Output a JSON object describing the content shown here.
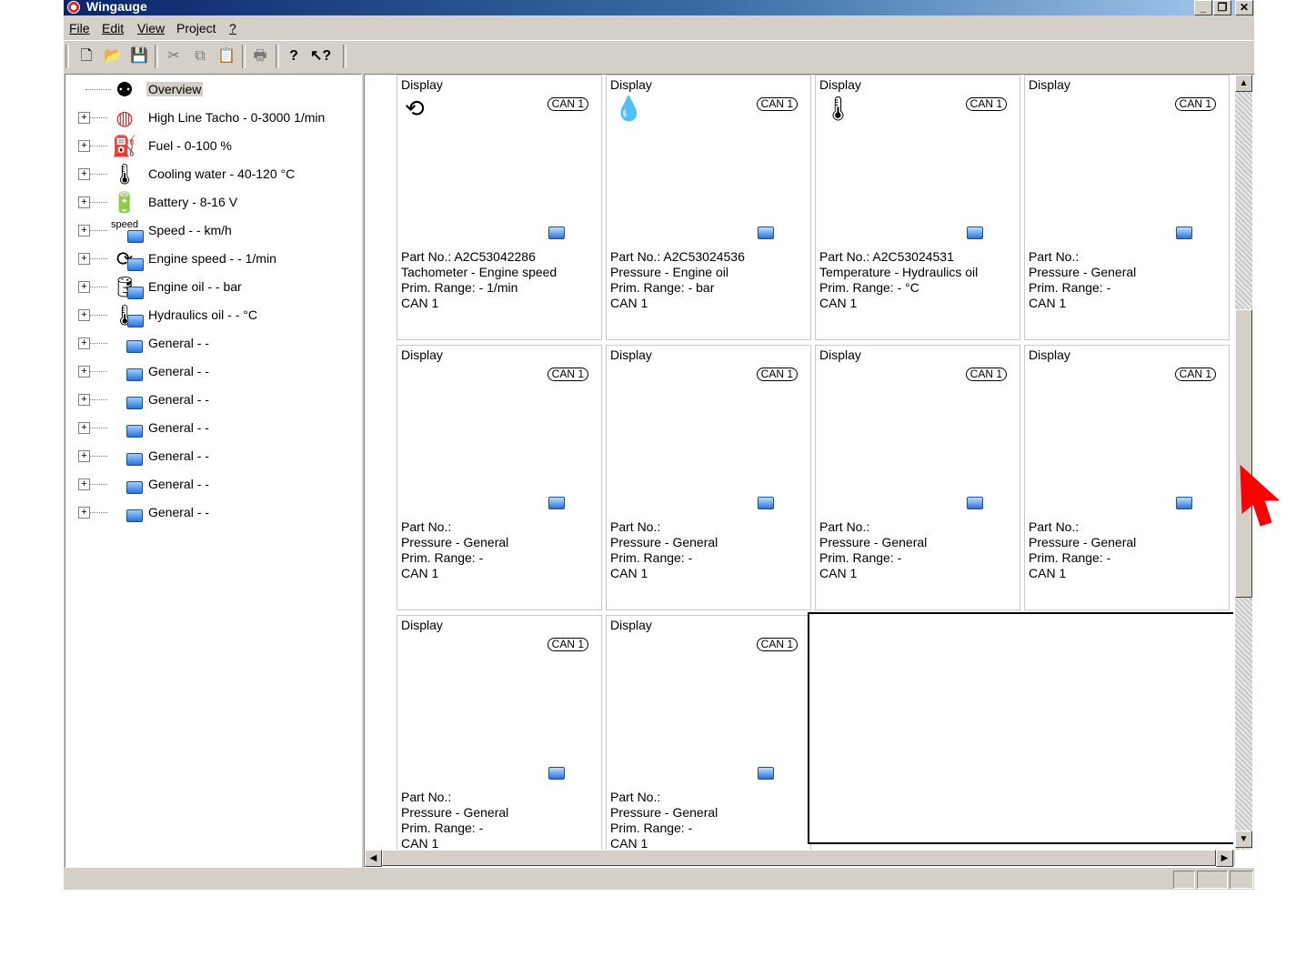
{
  "window": {
    "title": "Wingauge"
  },
  "menu": [
    {
      "label": "File"
    },
    {
      "label": "Edit"
    },
    {
      "label": "View"
    },
    {
      "label": "Project"
    },
    {
      "label": "?"
    }
  ],
  "toolbar": {
    "icons": [
      "new-document-icon",
      "open-folder-icon",
      "save-icon",
      "cut-icon",
      "copy-icon",
      "paste-icon",
      "print-icon",
      "help-icon",
      "context-help-icon"
    ]
  },
  "tree": {
    "items": [
      {
        "label": "Overview",
        "icon": "overview-icon"
      },
      {
        "label": "High Line Tacho - 0-3000 1/min",
        "icon": "tacho-icon"
      },
      {
        "label": "Fuel - 0-100 %",
        "icon": "fuel-icon"
      },
      {
        "label": "Cooling water - 40-120 °C",
        "icon": "cooling-water-icon"
      },
      {
        "label": "Battery - 8-16 V",
        "icon": "battery-icon"
      },
      {
        "label": "Speed - - km/h",
        "icon": "speed-icon"
      },
      {
        "label": "Engine speed - - 1/min",
        "icon": "engine-speed-icon"
      },
      {
        "label": "Engine oil - - bar",
        "icon": "engine-oil-icon"
      },
      {
        "label": "Hydraulics oil - - °C",
        "icon": "hydraulics-oil-icon"
      },
      {
        "label": "General - -",
        "icon": "display-icon"
      },
      {
        "label": "General - -",
        "icon": "display-icon"
      },
      {
        "label": "General - -",
        "icon": "display-icon"
      },
      {
        "label": "General - -",
        "icon": "display-icon"
      },
      {
        "label": "General - -",
        "icon": "display-icon"
      },
      {
        "label": "General - -",
        "icon": "display-icon"
      },
      {
        "label": "General - -",
        "icon": "display-icon"
      }
    ]
  },
  "cards": [
    {
      "caption": "Display",
      "can": "CAN 1",
      "icon": "rotation-icon",
      "part": "Part No.: A2C53042286",
      "type": "Tachometer - Engine speed",
      "range": "Prim. Range: - 1/min",
      "bus": "CAN 1"
    },
    {
      "caption": "Display",
      "can": "CAN 1",
      "icon": "oil-can-icon",
      "part": "Part No.: A2C53024536",
      "type": "Pressure - Engine oil",
      "range": "Prim. Range: - bar",
      "bus": "CAN 1"
    },
    {
      "caption": "Display",
      "can": "CAN 1",
      "icon": "hydraulic-temp-icon",
      "part": "Part No.: A2C53024531",
      "type": "Temperature - Hydraulics oil",
      "range": "Prim. Range: - °C",
      "bus": "CAN 1"
    },
    {
      "caption": "Display",
      "can": "CAN 1",
      "icon": "",
      "part": "Part No.:",
      "type": "Pressure - General",
      "range": "Prim. Range: -",
      "bus": "CAN 1"
    },
    {
      "caption": "Display",
      "can": "CAN 1",
      "icon": "",
      "part": "Part No.:",
      "type": "Pressure - General",
      "range": "Prim. Range: -",
      "bus": "CAN 1"
    },
    {
      "caption": "Display",
      "can": "CAN 1",
      "icon": "",
      "part": "Part No.:",
      "type": "Pressure - General",
      "range": "Prim. Range: -",
      "bus": "CAN 1"
    },
    {
      "caption": "Display",
      "can": "CAN 1",
      "icon": "",
      "part": "Part No.:",
      "type": "Pressure - General",
      "range": "Prim. Range: -",
      "bus": "CAN 1"
    },
    {
      "caption": "Display",
      "can": "CAN 1",
      "icon": "",
      "part": "Part No.:",
      "type": "Pressure - General",
      "range": "Prim. Range: -",
      "bus": "CAN 1"
    },
    {
      "caption": "Display",
      "can": "CAN 1",
      "icon": "",
      "part": "Part No.:",
      "type": "Pressure - General",
      "range": "Prim. Range: -",
      "bus": "CAN 1"
    },
    {
      "caption": "Display",
      "can": "CAN 1",
      "icon": "",
      "part": "Part No.:",
      "type": "Pressure - General",
      "range": "Prim. Range: -",
      "bus": "CAN 1"
    }
  ],
  "colors": {
    "titlebar_start": "#0a246a",
    "titlebar_end": "#a6caf0",
    "cursor": "#ff0000"
  }
}
